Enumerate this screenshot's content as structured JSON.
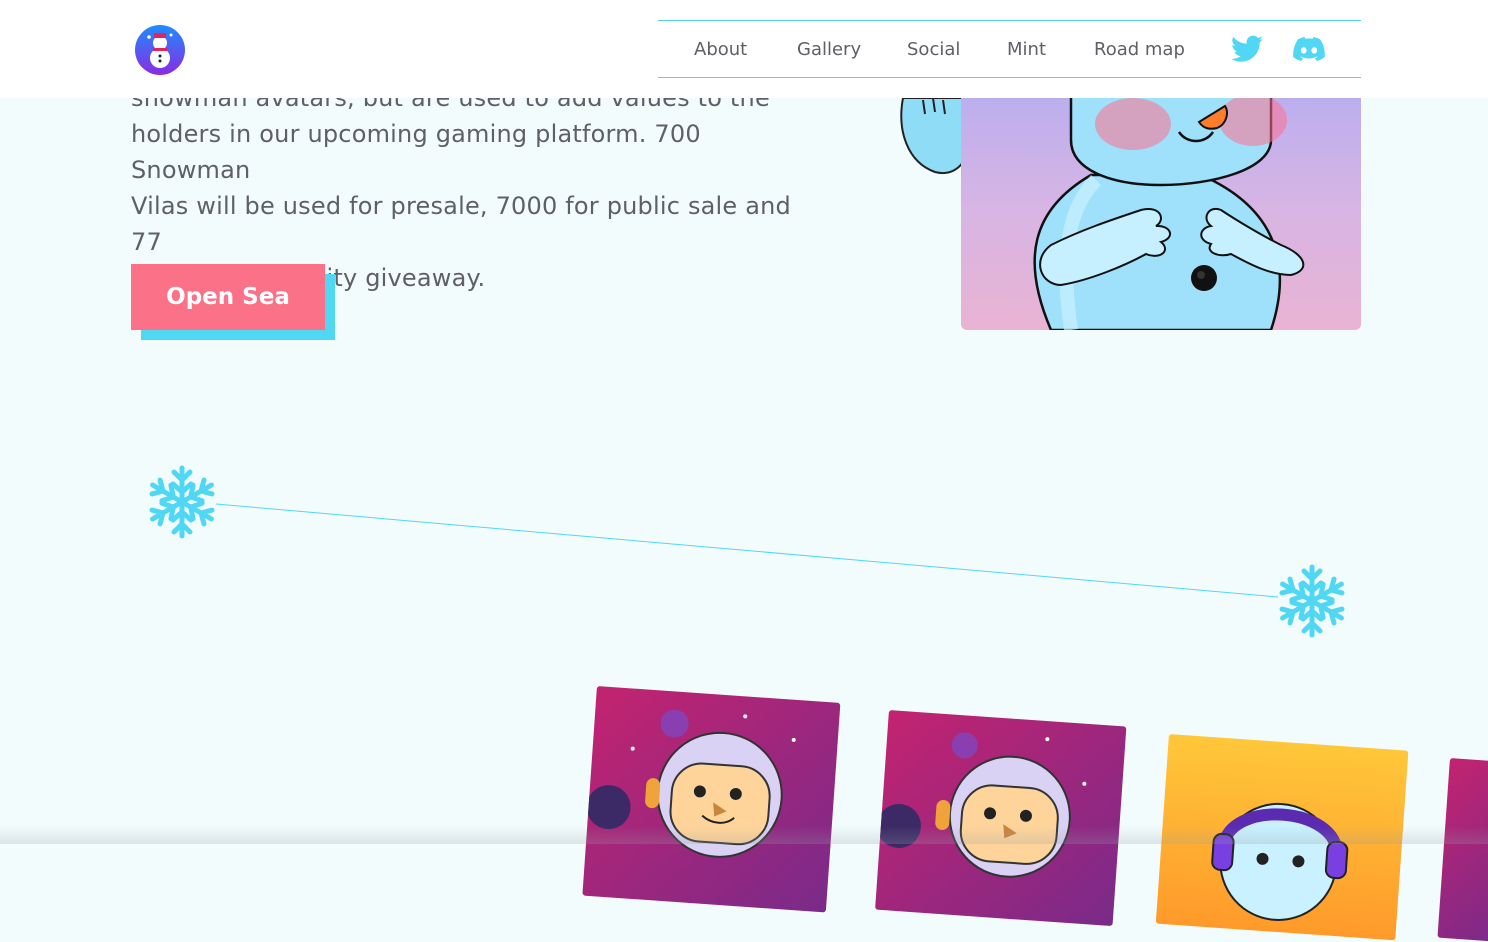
{
  "header": {
    "nav": [
      {
        "label": "About"
      },
      {
        "label": "Gallery"
      },
      {
        "label": "Social"
      },
      {
        "label": "Mint"
      },
      {
        "label": "Road map"
      }
    ],
    "social": [
      "twitter-icon",
      "discord-icon"
    ]
  },
  "about": {
    "line1": "snowman avatars, but are used to add values to the",
    "line2": "holders in our upcoming gaming platform. 700 Snowman",
    "line3": "Vilas will be used for presale, 7000 for public sale and 77",
    "line4": "for the community giveaway.",
    "cta_label": "Open Sea"
  },
  "colors": {
    "accent_pink": "#fb7187",
    "accent_cyan": "#50d7f4",
    "page_bg": "#f2fcfd",
    "text": "#5f6067"
  }
}
